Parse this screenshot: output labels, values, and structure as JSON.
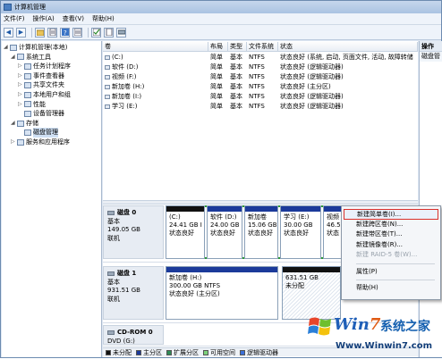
{
  "window": {
    "title": "计算机管理"
  },
  "menu": [
    "文件(F)",
    "操作(A)",
    "查看(V)",
    "帮助(H)"
  ],
  "toolbar": {
    "back": "◀",
    "forward": "▶"
  },
  "tree": [
    {
      "label": "计算机管理(本地)",
      "indent": 0,
      "exp": "◢"
    },
    {
      "label": "系统工具",
      "indent": 1,
      "exp": "◢"
    },
    {
      "label": "任务计划程序",
      "indent": 2,
      "exp": "▷"
    },
    {
      "label": "事件查看器",
      "indent": 2,
      "exp": "▷"
    },
    {
      "label": "共享文件夹",
      "indent": 2,
      "exp": "▷"
    },
    {
      "label": "本地用户和组",
      "indent": 2,
      "exp": "▷"
    },
    {
      "label": "性能",
      "indent": 2,
      "exp": "▷"
    },
    {
      "label": "设备管理器",
      "indent": 2,
      "exp": ""
    },
    {
      "label": "存储",
      "indent": 1,
      "exp": "◢"
    },
    {
      "label": "磁盘管理",
      "indent": 2,
      "exp": "",
      "selected": true
    },
    {
      "label": "服务和应用程序",
      "indent": 1,
      "exp": "▷"
    }
  ],
  "volumes": {
    "headers": [
      "卷",
      "布局",
      "类型",
      "文件系统",
      "状态"
    ],
    "rows": [
      [
        "(C:)",
        "简单",
        "基本",
        "NTFS",
        "状态良好 (系统, 启动, 页面文件, 活动, 故障转储"
      ],
      [
        "软件 (D:)",
        "简单",
        "基本",
        "NTFS",
        "状态良好 (逻辑驱动器)"
      ],
      [
        "视频 (F:)",
        "简单",
        "基本",
        "NTFS",
        "状态良好 (逻辑驱动器)"
      ],
      [
        "新加卷 (H:)",
        "简单",
        "基本",
        "NTFS",
        "状态良好 (主分区)"
      ],
      [
        "新加卷 (I:)",
        "简单",
        "基本",
        "NTFS",
        "状态良好 (逻辑驱动器)"
      ],
      [
        "学习 (E:)",
        "简单",
        "基本",
        "NTFS",
        "状态良好 (逻辑驱动器)"
      ]
    ]
  },
  "disks": [
    {
      "name": "磁盘 0",
      "type": "基本",
      "size": "149.05 GB",
      "status": "联机",
      "parts": [
        {
          "l1": "(C:)",
          "l2": "24.41 GB I",
          "l3": "状态良好"
        },
        {
          "l1": "软件 (D:)",
          "l2": "24.00 GB",
          "l3": "状态良好"
        },
        {
          "l1": "新加卷",
          "l2": "15.06 GB",
          "l3": "状态良好"
        },
        {
          "l1": "学习 (E:)",
          "l2": "30.00 GB",
          "l3": "状态良好"
        },
        {
          "l1": "视频",
          "l2": "46.5",
          "l3": "状态"
        }
      ]
    },
    {
      "name": "磁盘 1",
      "type": "基本",
      "size": "931.51 GB",
      "status": "联机",
      "parts": [
        {
          "l1": "新加卷 (H:)",
          "l2": "300.00 GB NTFS",
          "l3": "状态良好 (主分区)"
        },
        {
          "l1": "",
          "l2": "631.51 GB",
          "l3": "未分配"
        }
      ]
    },
    {
      "name": "CD-ROM 0",
      "type": "DVD (G:)",
      "size": "",
      "status": "",
      "parts": []
    }
  ],
  "legend": [
    {
      "label": "未分配",
      "color": "#111111"
    },
    {
      "label": "主分区",
      "color": "#1b3a9a"
    },
    {
      "label": "扩展分区",
      "color": "#2e8b57"
    },
    {
      "label": "可用空间",
      "color": "#7bd17b"
    },
    {
      "label": "逻辑驱动器",
      "color": "#3b6fd8"
    }
  ],
  "actions": {
    "header": "操作",
    "sub": "磁盘管"
  },
  "context_menu": [
    {
      "label": "新建简单卷(I)...",
      "state": "active"
    },
    {
      "label": "新建跨区卷(N)...",
      "state": "normal"
    },
    {
      "label": "新建带区卷(T)...",
      "state": "normal"
    },
    {
      "label": "新建镜像卷(R)...",
      "state": "normal"
    },
    {
      "label": "新建 RAID-5 卷(W)...",
      "state": "disabled"
    },
    {
      "sep": true
    },
    {
      "label": "属性(P)",
      "state": "normal"
    },
    {
      "sep": true
    },
    {
      "label": "帮助(H)",
      "state": "normal"
    }
  ],
  "watermark": {
    "brand_a": "Win",
    "brand_b": "7",
    "brand_c": "系统之家",
    "url": "Www.Winwin7.com"
  }
}
